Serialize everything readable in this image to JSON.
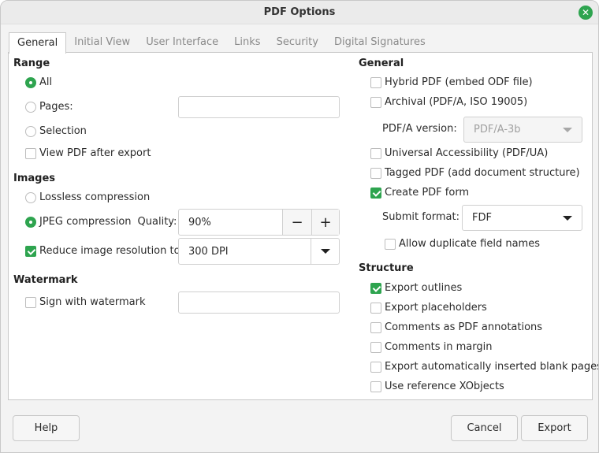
{
  "window": {
    "title": "PDF Options",
    "close_icon": "close-icon"
  },
  "tabs": [
    {
      "label": "General",
      "active": true
    },
    {
      "label": "Initial View",
      "active": false
    },
    {
      "label": "User Interface",
      "active": false
    },
    {
      "label": "Links",
      "active": false
    },
    {
      "label": "Security",
      "active": false
    },
    {
      "label": "Digital Signatures",
      "active": false
    }
  ],
  "range": {
    "heading": "Range",
    "all_label": "All",
    "all_selected": true,
    "pages_label": "Pages:",
    "pages_value": "",
    "selection_label": "Selection",
    "view_after_export_label": "View PDF after export",
    "view_after_export_checked": false
  },
  "images": {
    "heading": "Images",
    "lossless_label": "Lossless compression",
    "jpeg_label": "JPEG compression",
    "jpeg_selected": true,
    "quality_label": "Quality:",
    "quality_value": "90%",
    "decrement_label": "−",
    "increment_label": "+",
    "reduce_label": "Reduce image resolution to:",
    "reduce_checked": true,
    "resolution_value": "300 DPI"
  },
  "watermark": {
    "heading": "Watermark",
    "sign_label": "Sign with watermark",
    "sign_checked": false,
    "watermark_value": ""
  },
  "general": {
    "heading": "General",
    "hybrid_label": "Hybrid PDF (embed ODF file)",
    "archival_label": "Archival (PDF/A, ISO 19005)",
    "pdfa_version_label": "PDF/A version:",
    "pdfa_version_value": "PDF/A-3b",
    "ua_label": "Universal Accessibility (PDF/UA)",
    "tagged_label": "Tagged PDF (add document structure)",
    "create_form_label": "Create PDF form",
    "create_form_checked": true,
    "submit_format_label": "Submit format:",
    "submit_format_value": "FDF",
    "allow_duplicate_label": "Allow duplicate field names"
  },
  "structure": {
    "heading": "Structure",
    "export_outlines_label": "Export outlines",
    "export_outlines_checked": true,
    "export_placeholders_label": "Export placeholders",
    "comments_annotations_label": "Comments as PDF annotations",
    "comments_margin_label": "Comments in margin",
    "blank_pages_label": "Export automatically inserted blank pages",
    "xobjects_label": "Use reference XObjects"
  },
  "buttons": {
    "help": "Help",
    "cancel": "Cancel",
    "export": "Export"
  },
  "colors": {
    "accent": "#2ea44f"
  }
}
